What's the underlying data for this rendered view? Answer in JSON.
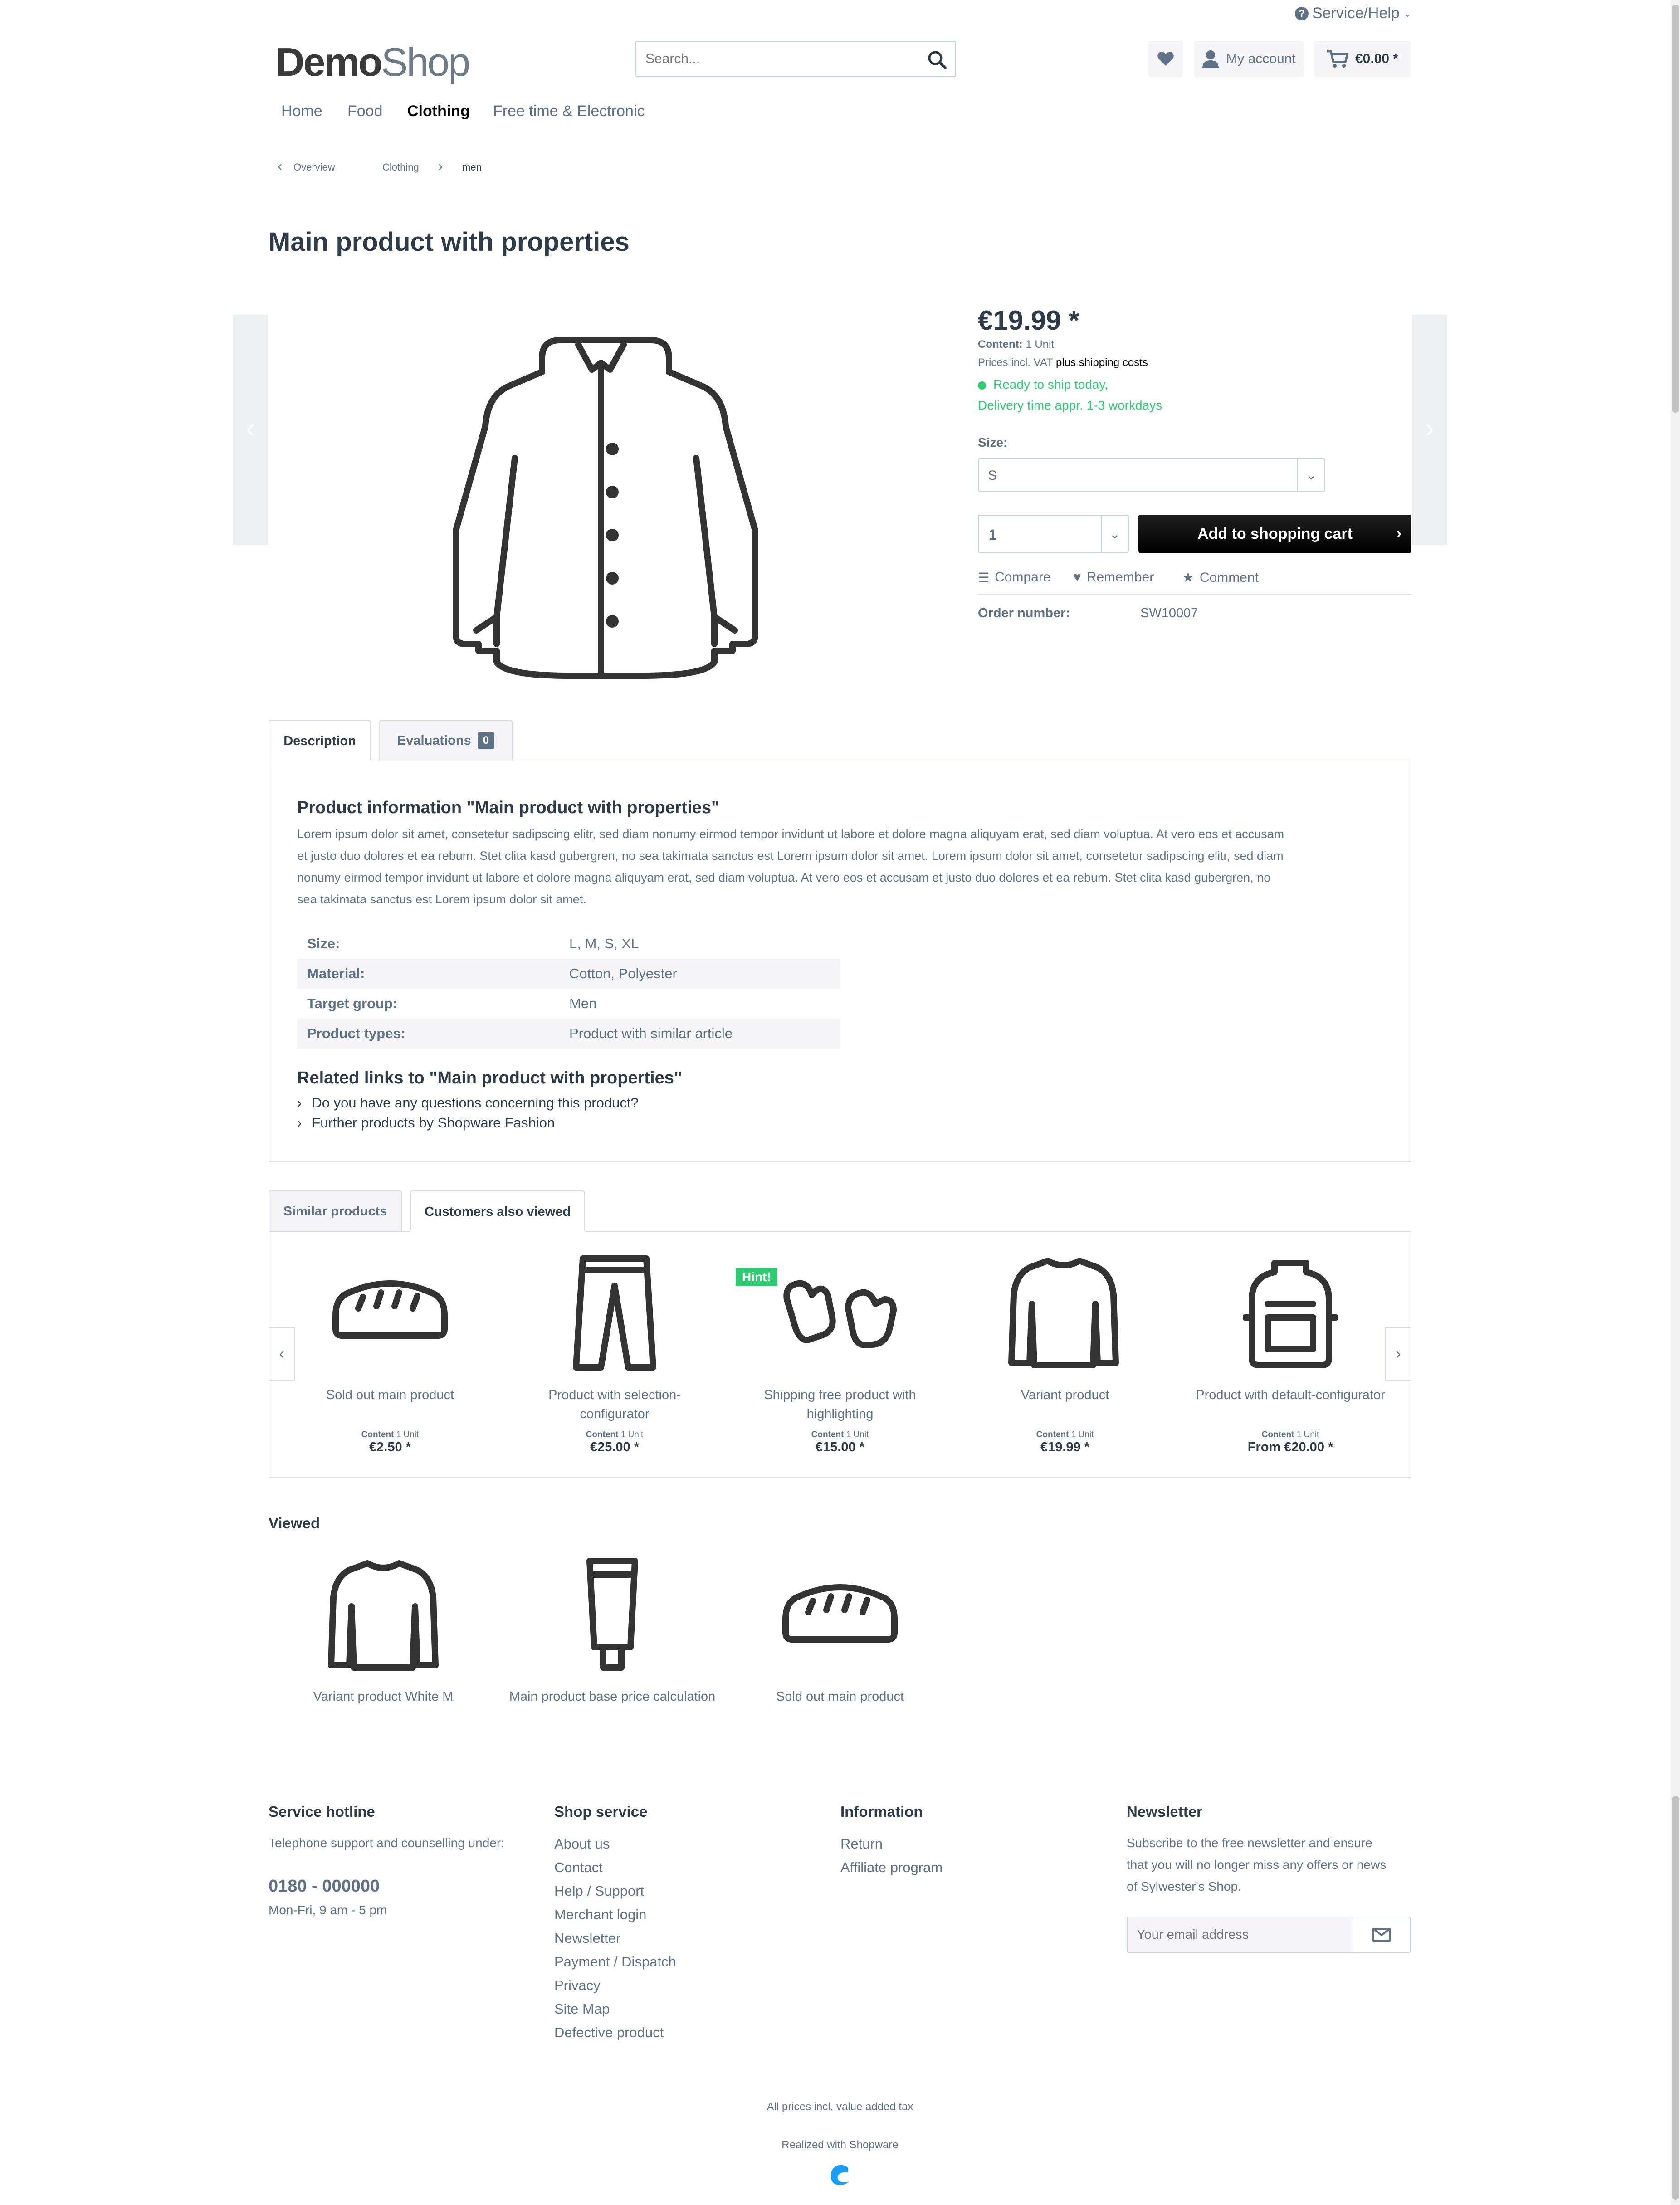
{
  "header": {
    "service_help": "Service/Help",
    "logo_part1": "Demo",
    "logo_part2": "Shop",
    "search_placeholder": "Search...",
    "account": "My account",
    "cart_total": "€0.00 *"
  },
  "nav": [
    "Home",
    "Food",
    "Clothing",
    "Free time & Electronic"
  ],
  "breadcrumb": {
    "back": "Overview",
    "level1": "Clothing",
    "level2": "men"
  },
  "product": {
    "title": "Main product with properties",
    "price": "€19.99 *",
    "content_label": "Content:",
    "content_value": "1 Unit",
    "vat_text": "Prices incl. VAT",
    "shipping_text": "plus shipping costs",
    "ship_line1": "Ready to ship today,",
    "ship_line2": "Delivery time appr. 1-3 workdays",
    "size_label": "Size:",
    "size_value": "S",
    "quantity": "1",
    "add_to_cart": "Add to shopping cart",
    "compare": "Compare",
    "remember": "Remember",
    "comment": "Comment",
    "order_label": "Order number:",
    "order_number": "SW10007"
  },
  "tabs": {
    "description": "Description",
    "evaluations": "Evaluations",
    "eval_count": "0"
  },
  "description": {
    "heading": "Product information \"Main product with properties\"",
    "lines": [
      "Lorem ipsum dolor sit amet, consetetur sadipscing elitr, sed diam nonumy eirmod tempor invidunt ut labore et dolore magna aliquyam erat, sed diam voluptua. At vero eos et accusam",
      "et justo duo dolores et ea rebum. Stet clita kasd gubergren, no sea takimata sanctus est Lorem ipsum dolor sit amet. Lorem ipsum dolor sit amet, consetetur sadipscing elitr, sed diam",
      "nonumy eirmod tempor invidunt ut labore et dolore magna aliquyam erat, sed diam voluptua. At vero eos et accusam et justo duo dolores et ea rebum. Stet clita kasd gubergren, no",
      "sea takimata sanctus est Lorem ipsum dolor sit amet."
    ],
    "properties": [
      {
        "key": "Size:",
        "value": "L, M, S, XL"
      },
      {
        "key": "Material:",
        "value": "Cotton, Polyester"
      },
      {
        "key": "Target group:",
        "value": "Men"
      },
      {
        "key": "Product types:",
        "value": "Product with similar article"
      }
    ],
    "related_heading": "Related links to \"Main product with properties\"",
    "related_links": [
      "Do you have any questions concerning this product?",
      "Further products by Shopware Fashion"
    ]
  },
  "recommend_tabs": {
    "similar": "Similar products",
    "also_viewed": "Customers also viewed"
  },
  "hint_badge": "Hint!",
  "content_label": "Content",
  "unit": "1 Unit",
  "also_viewed": [
    {
      "name_l1": "Sold out main product",
      "name_l2": "",
      "price": "€2.50 *",
      "icon": "bread-icon"
    },
    {
      "name_l1": "Product with selection-",
      "name_l2": "configurator",
      "price": "€25.00 *",
      "icon": "trousers-icon"
    },
    {
      "name_l1": "Shipping free product with",
      "name_l2": "highlighting",
      "price": "€15.00 *",
      "icon": "mittens-icon"
    },
    {
      "name_l1": "Variant product",
      "name_l2": "",
      "price": "€19.99 *",
      "icon": "sweater-icon"
    },
    {
      "name_l1": "Product with default-configurator",
      "name_l2": "",
      "price": "From €20.00 *",
      "icon": "backpack-icon"
    }
  ],
  "viewed": {
    "heading": "Viewed",
    "items": [
      "Variant product White M",
      "Main product base price calculation",
      "Sold out main product"
    ]
  },
  "footer": {
    "hotline_heading": "Service hotline",
    "hotline_text": "Telephone support and counselling under:",
    "phone": "0180 - 000000",
    "hours": "Mon-Fri, 9 am - 5 pm",
    "shop_service_heading": "Shop service",
    "shop_service_links": [
      "About us",
      "Contact",
      "Help / Support",
      "Merchant login",
      "Newsletter",
      "Payment / Dispatch",
      "Privacy",
      "Site Map",
      "Defective product"
    ],
    "information_heading": "Information",
    "information_links": [
      "Return",
      "Affiliate program"
    ],
    "newsletter_heading": "Newsletter",
    "newsletter_lines": [
      "Subscribe to the free newsletter and ensure",
      "that you will no longer miss any offers or news",
      "of Sylwester's Shop."
    ],
    "email_placeholder": "Your email address",
    "tax_note": "All prices incl. value added tax",
    "realized": "Realized with Shopware"
  },
  "colors": {
    "accent_green": "#2ecc71",
    "text": "#5f7285",
    "dark": "#2f3c48",
    "shopware_blue": "#189eff"
  }
}
